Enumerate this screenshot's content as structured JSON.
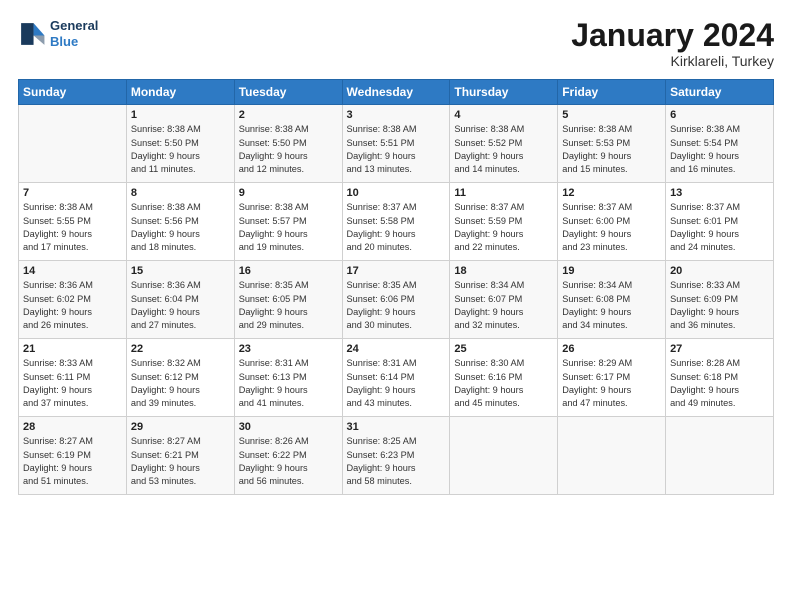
{
  "header": {
    "logo_line1": "General",
    "logo_line2": "Blue",
    "month": "January 2024",
    "location": "Kirklareli, Turkey"
  },
  "weekdays": [
    "Sunday",
    "Monday",
    "Tuesday",
    "Wednesday",
    "Thursday",
    "Friday",
    "Saturday"
  ],
  "weeks": [
    [
      {
        "day": "",
        "info": ""
      },
      {
        "day": "1",
        "info": "Sunrise: 8:38 AM\nSunset: 5:50 PM\nDaylight: 9 hours\nand 11 minutes."
      },
      {
        "day": "2",
        "info": "Sunrise: 8:38 AM\nSunset: 5:50 PM\nDaylight: 9 hours\nand 12 minutes."
      },
      {
        "day": "3",
        "info": "Sunrise: 8:38 AM\nSunset: 5:51 PM\nDaylight: 9 hours\nand 13 minutes."
      },
      {
        "day": "4",
        "info": "Sunrise: 8:38 AM\nSunset: 5:52 PM\nDaylight: 9 hours\nand 14 minutes."
      },
      {
        "day": "5",
        "info": "Sunrise: 8:38 AM\nSunset: 5:53 PM\nDaylight: 9 hours\nand 15 minutes."
      },
      {
        "day": "6",
        "info": "Sunrise: 8:38 AM\nSunset: 5:54 PM\nDaylight: 9 hours\nand 16 minutes."
      }
    ],
    [
      {
        "day": "7",
        "info": "Sunrise: 8:38 AM\nSunset: 5:55 PM\nDaylight: 9 hours\nand 17 minutes."
      },
      {
        "day": "8",
        "info": "Sunrise: 8:38 AM\nSunset: 5:56 PM\nDaylight: 9 hours\nand 18 minutes."
      },
      {
        "day": "9",
        "info": "Sunrise: 8:38 AM\nSunset: 5:57 PM\nDaylight: 9 hours\nand 19 minutes."
      },
      {
        "day": "10",
        "info": "Sunrise: 8:37 AM\nSunset: 5:58 PM\nDaylight: 9 hours\nand 20 minutes."
      },
      {
        "day": "11",
        "info": "Sunrise: 8:37 AM\nSunset: 5:59 PM\nDaylight: 9 hours\nand 22 minutes."
      },
      {
        "day": "12",
        "info": "Sunrise: 8:37 AM\nSunset: 6:00 PM\nDaylight: 9 hours\nand 23 minutes."
      },
      {
        "day": "13",
        "info": "Sunrise: 8:37 AM\nSunset: 6:01 PM\nDaylight: 9 hours\nand 24 minutes."
      }
    ],
    [
      {
        "day": "14",
        "info": "Sunrise: 8:36 AM\nSunset: 6:02 PM\nDaylight: 9 hours\nand 26 minutes."
      },
      {
        "day": "15",
        "info": "Sunrise: 8:36 AM\nSunset: 6:04 PM\nDaylight: 9 hours\nand 27 minutes."
      },
      {
        "day": "16",
        "info": "Sunrise: 8:35 AM\nSunset: 6:05 PM\nDaylight: 9 hours\nand 29 minutes."
      },
      {
        "day": "17",
        "info": "Sunrise: 8:35 AM\nSunset: 6:06 PM\nDaylight: 9 hours\nand 30 minutes."
      },
      {
        "day": "18",
        "info": "Sunrise: 8:34 AM\nSunset: 6:07 PM\nDaylight: 9 hours\nand 32 minutes."
      },
      {
        "day": "19",
        "info": "Sunrise: 8:34 AM\nSunset: 6:08 PM\nDaylight: 9 hours\nand 34 minutes."
      },
      {
        "day": "20",
        "info": "Sunrise: 8:33 AM\nSunset: 6:09 PM\nDaylight: 9 hours\nand 36 minutes."
      }
    ],
    [
      {
        "day": "21",
        "info": "Sunrise: 8:33 AM\nSunset: 6:11 PM\nDaylight: 9 hours\nand 37 minutes."
      },
      {
        "day": "22",
        "info": "Sunrise: 8:32 AM\nSunset: 6:12 PM\nDaylight: 9 hours\nand 39 minutes."
      },
      {
        "day": "23",
        "info": "Sunrise: 8:31 AM\nSunset: 6:13 PM\nDaylight: 9 hours\nand 41 minutes."
      },
      {
        "day": "24",
        "info": "Sunrise: 8:31 AM\nSunset: 6:14 PM\nDaylight: 9 hours\nand 43 minutes."
      },
      {
        "day": "25",
        "info": "Sunrise: 8:30 AM\nSunset: 6:16 PM\nDaylight: 9 hours\nand 45 minutes."
      },
      {
        "day": "26",
        "info": "Sunrise: 8:29 AM\nSunset: 6:17 PM\nDaylight: 9 hours\nand 47 minutes."
      },
      {
        "day": "27",
        "info": "Sunrise: 8:28 AM\nSunset: 6:18 PM\nDaylight: 9 hours\nand 49 minutes."
      }
    ],
    [
      {
        "day": "28",
        "info": "Sunrise: 8:27 AM\nSunset: 6:19 PM\nDaylight: 9 hours\nand 51 minutes."
      },
      {
        "day": "29",
        "info": "Sunrise: 8:27 AM\nSunset: 6:21 PM\nDaylight: 9 hours\nand 53 minutes."
      },
      {
        "day": "30",
        "info": "Sunrise: 8:26 AM\nSunset: 6:22 PM\nDaylight: 9 hours\nand 56 minutes."
      },
      {
        "day": "31",
        "info": "Sunrise: 8:25 AM\nSunset: 6:23 PM\nDaylight: 9 hours\nand 58 minutes."
      },
      {
        "day": "",
        "info": ""
      },
      {
        "day": "",
        "info": ""
      },
      {
        "day": "",
        "info": ""
      }
    ]
  ]
}
